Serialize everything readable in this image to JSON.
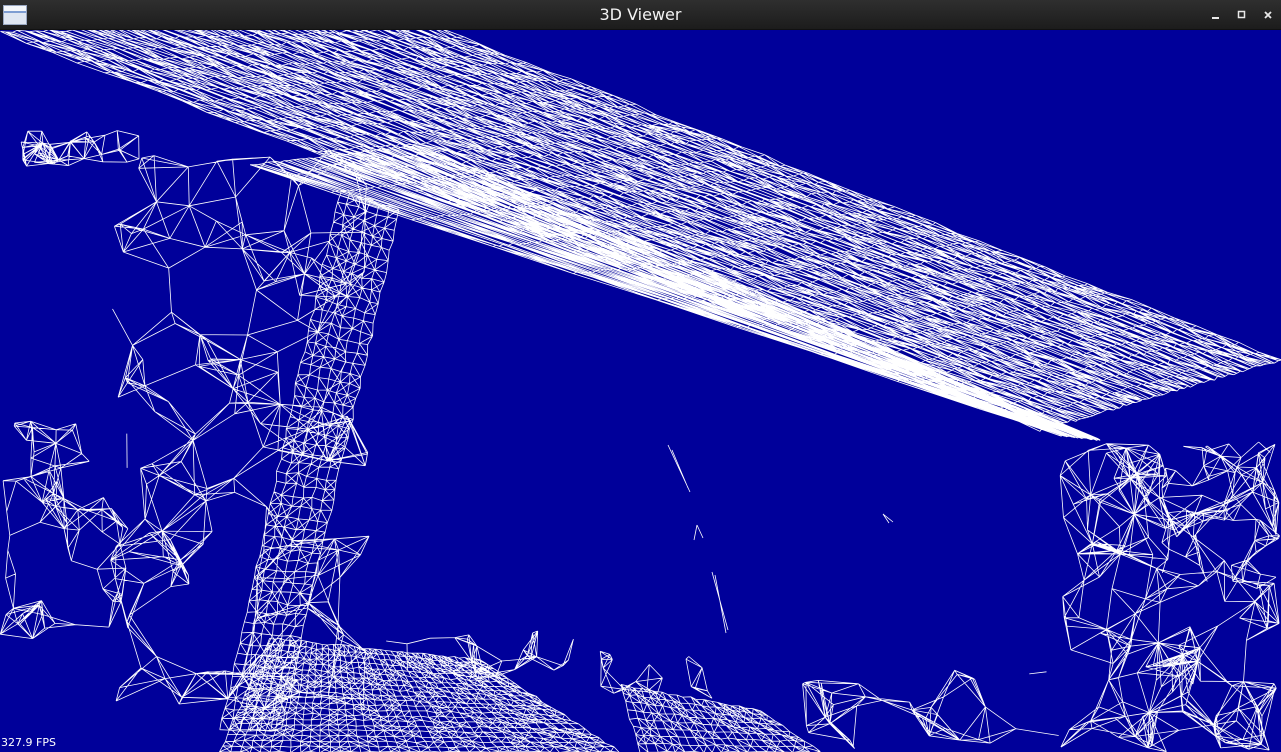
{
  "window": {
    "title": "3D Viewer",
    "background_color": "#00009a",
    "mesh_color": "#ffffff",
    "controls": {
      "minimize_icon": "minimize-icon",
      "maximize_icon": "maximize-icon",
      "close_icon": "close-icon"
    }
  },
  "viewport": {
    "render_mode": "wireframe",
    "fps_label": "327.9 FPS"
  }
}
